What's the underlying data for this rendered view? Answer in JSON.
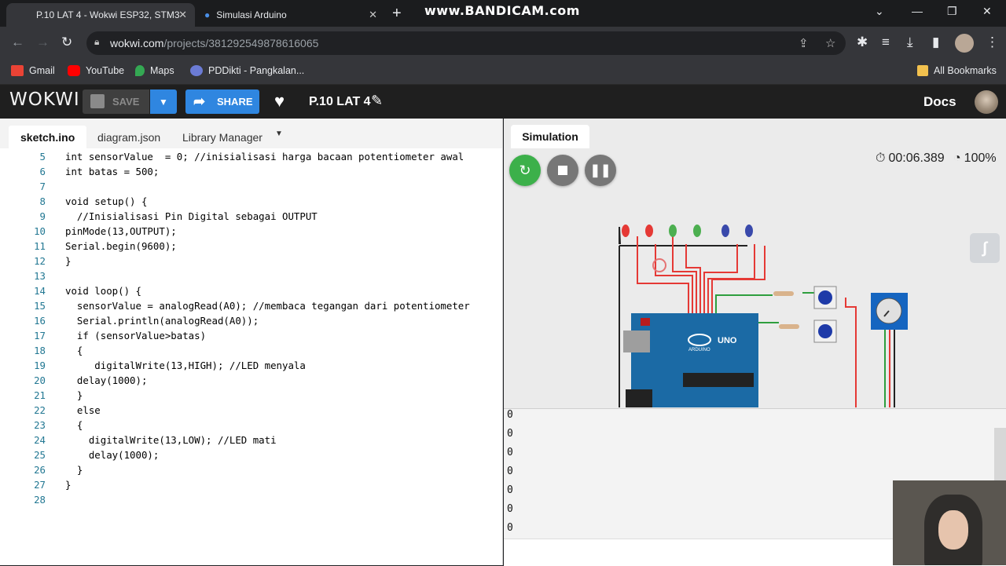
{
  "browser": {
    "tabs": [
      {
        "title": "P.10 LAT 4 - Wokwi ESP32, STM3"
      },
      {
        "title": "Simulasi Arduino"
      }
    ],
    "watermark": "www.BANDICAM.com",
    "address": {
      "host": "wokwi.com",
      "path": "/projects/381292549878616065"
    },
    "bookmarks": [
      {
        "label": "Gmail",
        "color": "#ea4335"
      },
      {
        "label": "YouTube",
        "color": "#ff0000"
      },
      {
        "label": "Maps",
        "color": "#34a853"
      },
      {
        "label": "PDDikti - Pangkalan...",
        "color": "#6b7bd4"
      }
    ],
    "all_bookmarks": "All Bookmarks"
  },
  "wokwi": {
    "logo": "WOKWI",
    "save_label": "SAVE",
    "share_label": "SHARE",
    "project_title": "P.10 LAT 4",
    "docs_label": "Docs"
  },
  "editor": {
    "tabs": [
      "sketch.ino",
      "diagram.json",
      "Library Manager"
    ],
    "active_tab": "sketch.ino",
    "lines": [
      {
        "n": "5",
        "t": "int sensorValue  = 0; //inisialisasi harga bacaan potentiometer awal"
      },
      {
        "n": "6",
        "t": "int batas = 500;"
      },
      {
        "n": "7",
        "t": ""
      },
      {
        "n": "8",
        "t": "void setup() {"
      },
      {
        "n": "9",
        "t": "  //Inisialisasi Pin Digital sebagai OUTPUT"
      },
      {
        "n": "10",
        "t": "pinMode(13,OUTPUT);"
      },
      {
        "n": "11",
        "t": "Serial.begin(9600);"
      },
      {
        "n": "12",
        "t": "}"
      },
      {
        "n": "13",
        "t": ""
      },
      {
        "n": "14",
        "t": "void loop() {"
      },
      {
        "n": "15",
        "t": "  sensorValue = analogRead(A0); //membaca tegangan dari potentiometer"
      },
      {
        "n": "16",
        "t": "  Serial.println(analogRead(A0));"
      },
      {
        "n": "17",
        "t": "  if (sensorValue>batas)"
      },
      {
        "n": "18",
        "t": "  {"
      },
      {
        "n": "19",
        "t": "     digitalWrite(13,HIGH); //LED menyala"
      },
      {
        "n": "20",
        "t": "  delay(1000);"
      },
      {
        "n": "21",
        "t": "  }"
      },
      {
        "n": "22",
        "t": "  else"
      },
      {
        "n": "23",
        "t": "  {"
      },
      {
        "n": "24",
        "t": "    digitalWrite(13,LOW); //LED mati"
      },
      {
        "n": "25",
        "t": "    delay(1000);"
      },
      {
        "n": "26",
        "t": "  }"
      },
      {
        "n": "27",
        "t": "}"
      },
      {
        "n": "28",
        "t": ""
      }
    ]
  },
  "simulation": {
    "tab_label": "Simulation",
    "timer": "00:06.389",
    "speed": "100%",
    "board_label": "UNO",
    "board_brand": "ARDUINO",
    "serial_lines": [
      "0",
      "0",
      "0",
      "0",
      "0",
      "0",
      "0"
    ],
    "colors": {
      "restart": "#3cb04a",
      "stop": "#777777",
      "pause": "#777777"
    }
  }
}
